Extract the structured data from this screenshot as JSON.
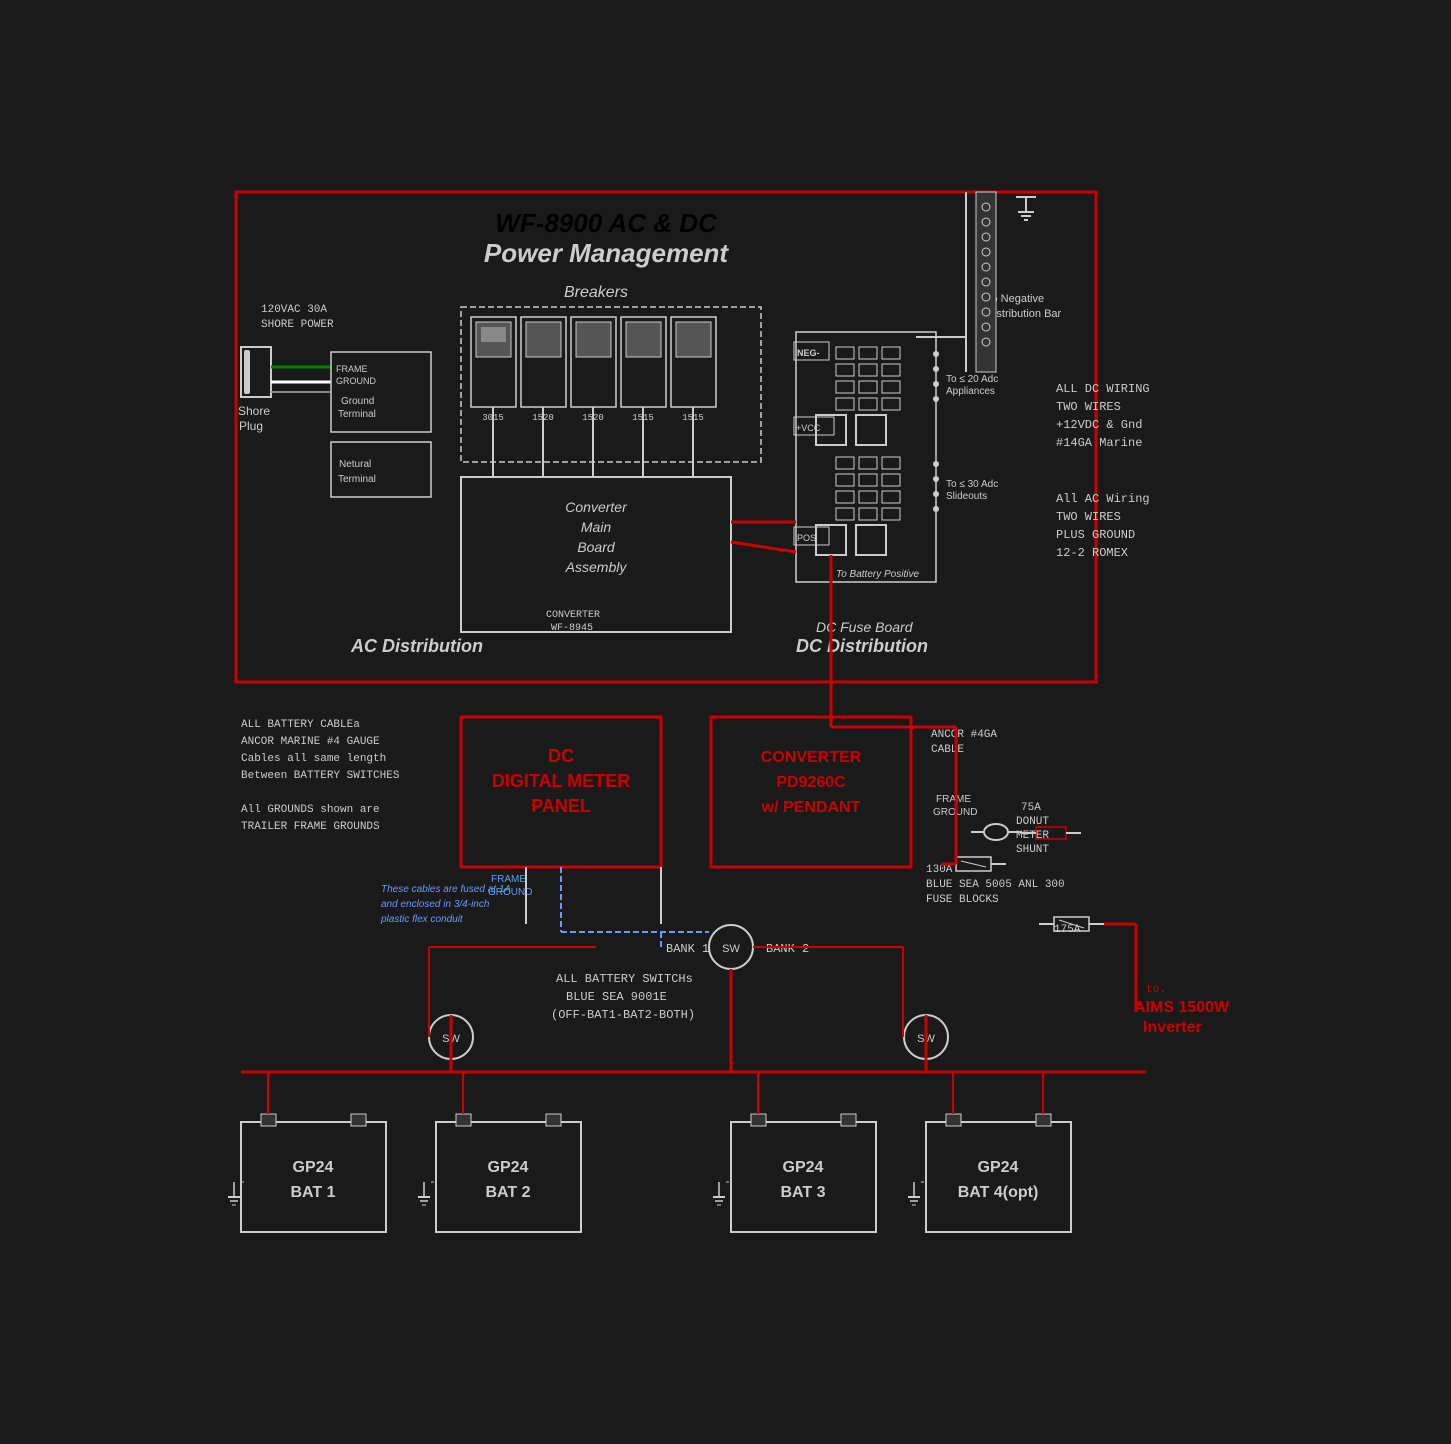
{
  "title": "WF-8900 AC & DC Power Management",
  "diagram": {
    "main_title_line1": "WF-8900 AC & DC",
    "main_title_line2": "Power Management",
    "shore_power_label": "120VAC 30A",
    "shore_power_label2": "SHORE POWER",
    "shore_plug_label": "Shore Plug",
    "frame_ground": "FRAME GROUND",
    "ground_terminal": "Ground Terminal",
    "neutral_terminal": "Netural Terminal",
    "breakers_label": "Breakers",
    "breaker_values": [
      "3015",
      "1520",
      "1520",
      "1515",
      "1515"
    ],
    "converter_main": "Converter Main Board Assembly",
    "converter_label": "CONVERTER",
    "converter_model": "WF-8945",
    "ac_distribution": "AC Distribution",
    "dc_distribution": "DC Distribution",
    "dc_fuse_board": "DC Fuse Board",
    "neg_label": "NEG",
    "pos_label": "POS",
    "vcc_label": "+VCC",
    "to_neg_dist": "To Negative Distribution Bar",
    "to_20adc": "To ≤ 20 Adc Appliances",
    "to_30adc": "To ≤ 30 Adc Slideouts",
    "to_battery_pos": "To Battery Positive",
    "dc_wiring_note1": "ALL DC WIRING",
    "dc_wiring_note2": "TWO WIRES",
    "dc_wiring_note3": "+12VDC & Gnd",
    "dc_wiring_note4": "#14GA Marine",
    "ac_wiring_note1": "All AC Wiring",
    "ac_wiring_note2": "TWO WIRES",
    "ac_wiring_note3": "PLUS GROUND",
    "ac_wiring_note4": "12-2 ROMEX",
    "battery_cable_note1": "ALL BATTERY CABLEa",
    "battery_cable_note2": "ANCOR MARINE #4 GAUGE",
    "battery_cable_note3": "Cables all same length",
    "battery_cable_note4": "Between BATTERY SWITCHES",
    "grounds_note1": "All GROUNDS shown are",
    "grounds_note2": "TRAILER FRAME GROUNDS",
    "fused_note1": "These cables are fused at 1A",
    "fused_note2": "and enclosed in 3/4-inch",
    "fused_note3": "plastic flex conduit",
    "dc_meter_panel": "DC DIGITAL METER PANEL",
    "converter_pendant": "CONVERTER PD9260C w/ PENDANT",
    "ancor_cable": "ANCOR #4GA CABLE",
    "frame_ground2": "FRAME GROUND",
    "donut_meter": "75A DONUT METER SHUNT",
    "fuse_130a": "130A",
    "fuse_blocks": "BLUE SEA 5005 ANL 300 FUSE BLOCKS",
    "fuse_175a": "175A",
    "bank1": "BANK 1",
    "bank2": "BANK 2",
    "switches_label1": "ALL BATTERY SWITCHs",
    "switches_label2": "BLUE SEA 9001E",
    "switches_label3": "(OFF-BAT1-BAT2-BOTH)",
    "aims_label1": "to.",
    "aims_label2": "AIMS 1500W",
    "aims_label3": "Inverter",
    "batteries": [
      {
        "label1": "GP24",
        "label2": "BAT 1"
      },
      {
        "label1": "GP24",
        "label2": "BAT 2"
      },
      {
        "label1": "GP24",
        "label2": "BAT 3"
      },
      {
        "label1": "GP24",
        "label2": "BAT 4(opt)"
      }
    ]
  }
}
